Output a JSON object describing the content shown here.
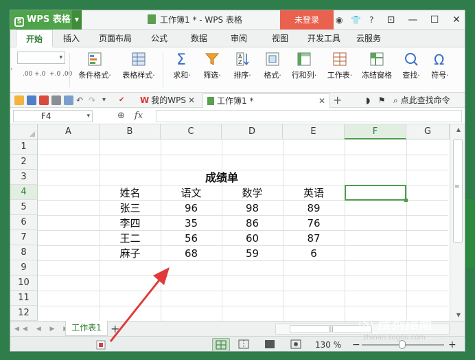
{
  "app": {
    "name": "WPS 表格",
    "doc_title": "工作簿1 * - WPS 表格",
    "login_label": "未登录",
    "help_label": "?"
  },
  "menu": {
    "tabs": [
      {
        "label": "开始",
        "active": true
      },
      {
        "label": "插入"
      },
      {
        "label": "页面布局"
      },
      {
        "label": "公式"
      },
      {
        "label": "数据"
      },
      {
        "label": "审阅"
      },
      {
        "label": "视图"
      },
      {
        "label": "开发工具"
      },
      {
        "label": "云服务"
      }
    ]
  },
  "ribbon": {
    "buttons": [
      {
        "label": "条件格式·",
        "icon": "conditional-format-icon"
      },
      {
        "label": "表格样式·",
        "icon": "table-style-icon"
      },
      {
        "label": "求和·",
        "icon": "sum-icon"
      },
      {
        "label": "筛选·",
        "icon": "filter-icon"
      },
      {
        "label": "排序·",
        "icon": "sort-icon"
      },
      {
        "label": "格式·",
        "icon": "format-icon"
      },
      {
        "label": "行和列·",
        "icon": "row-col-icon"
      },
      {
        "label": "工作表·",
        "icon": "worksheet-icon"
      },
      {
        "label": "冻结窗格",
        "icon": "freeze-pane-icon"
      },
      {
        "label": "查找·",
        "icon": "find-icon"
      },
      {
        "label": "符号·",
        "icon": "symbol-icon"
      }
    ],
    "decimal_labels": [
      ".00 +.0",
      "+.0 .00"
    ]
  },
  "quickbar": {
    "wps_tab": "我的WPS",
    "book_tab": "工作簿1 *",
    "search_label": "点此查找命令"
  },
  "formula": {
    "cell_ref": "F4",
    "fx_label": "fx"
  },
  "sheet": {
    "columns": [
      "A",
      "B",
      "C",
      "D",
      "E",
      "F",
      "G"
    ],
    "rows": [
      "1",
      "2",
      "3",
      "4",
      "5",
      "6",
      "7",
      "8",
      "9",
      "10",
      "11",
      "12"
    ],
    "selected_cell": "F4",
    "title": "成绩单",
    "header": [
      "姓名",
      "语文",
      "数学",
      "英语"
    ],
    "data": [
      [
        "张三",
        "96",
        "98",
        "89"
      ],
      [
        "李四",
        "35",
        "86",
        "76"
      ],
      [
        "王二",
        "56",
        "60",
        "87"
      ],
      [
        "麻子",
        "68",
        "59",
        "6"
      ]
    ]
  },
  "tabs": {
    "sheet_name": "工作表1",
    "add_label": "+"
  },
  "status": {
    "zoom": "130 %",
    "minus": "−",
    "plus": "+"
  },
  "watermark": {
    "text": "搜狗指南",
    "url": "zhinan.sogou.com"
  },
  "colors": {
    "accent_green": "#4b9d48",
    "login_red": "#e9614f",
    "arrow_red": "#e03a3a"
  }
}
